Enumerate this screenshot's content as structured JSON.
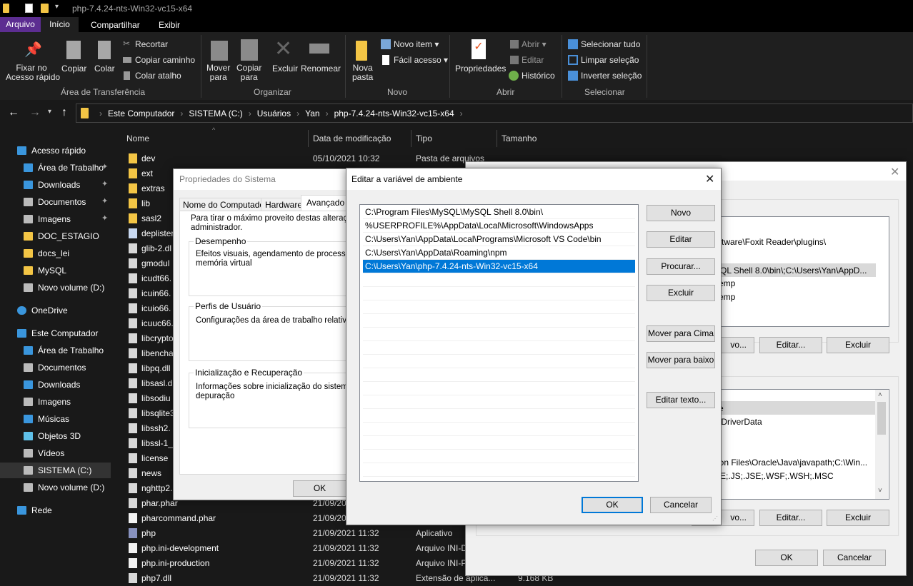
{
  "window": {
    "title": "php-7.4.24-nts-Win32-vc15-x64"
  },
  "ribbon": {
    "tabs": [
      "Arquivo",
      "Início",
      "Compartilhar",
      "Exibir"
    ],
    "clipboard": {
      "pin": "Fixar no",
      "pin2": "Acesso rápido",
      "copy": "Copiar",
      "paste": "Colar",
      "cut": "Recortar",
      "copy_path": "Copiar caminho",
      "paste_shortcut": "Colar atalho",
      "group": "Área de Transferência"
    },
    "organize": {
      "move": "Mover",
      "move2": "para",
      "copyto": "Copiar",
      "copyto2": "para",
      "delete": "Excluir",
      "rename": "Renomear",
      "group": "Organizar"
    },
    "new": {
      "new_folder": "Nova",
      "new_folder2": "pasta",
      "new_item": "Novo item",
      "easy_access": "Fácil acesso",
      "group": "Novo"
    },
    "open": {
      "properties": "Propriedades",
      "open": "Abrir",
      "edit": "Editar",
      "history": "Histórico",
      "group": "Abrir"
    },
    "select": {
      "all": "Selecionar tudo",
      "none": "Limpar seleção",
      "invert": "Inverter seleção",
      "group": "Selecionar"
    }
  },
  "breadcrumb": [
    "Este Computador",
    "SISTEMA (C:)",
    "Usuários",
    "Yan",
    "php-7.4.24-nts-Win32-vc15-x64"
  ],
  "columns": {
    "name": "Nome",
    "date": "Data de modificação",
    "type": "Tipo",
    "size": "Tamanho"
  },
  "sidebar": [
    {
      "label": "Acesso rápido",
      "icon": "star-icon",
      "ind": 0
    },
    {
      "label": "Área de Trabalho",
      "icon": "desktop-icon",
      "ind": 1,
      "pin": true
    },
    {
      "label": "Downloads",
      "icon": "download-icon",
      "ind": 1,
      "pin": true
    },
    {
      "label": "Documentos",
      "icon": "document-icon",
      "ind": 1,
      "pin": true
    },
    {
      "label": "Imagens",
      "icon": "image-icon",
      "ind": 1,
      "pin": true
    },
    {
      "label": "DOC_ESTAGIO",
      "icon": "folder-icon",
      "ind": 1
    },
    {
      "label": "docs_lei",
      "icon": "folder-icon",
      "ind": 1
    },
    {
      "label": "MySQL",
      "icon": "folder-icon",
      "ind": 1
    },
    {
      "label": "Novo volume (D:)",
      "icon": "drive-icon",
      "ind": 1
    },
    {
      "label": "OneDrive",
      "icon": "cloud-icon",
      "ind": 0,
      "gap": true
    },
    {
      "label": "Este Computador",
      "icon": "computer-icon",
      "ind": 0,
      "gap": true
    },
    {
      "label": "Área de Trabalho",
      "icon": "desktop-icon",
      "ind": 1
    },
    {
      "label": "Documentos",
      "icon": "document-icon",
      "ind": 1
    },
    {
      "label": "Downloads",
      "icon": "download-icon",
      "ind": 1
    },
    {
      "label": "Imagens",
      "icon": "image-icon",
      "ind": 1
    },
    {
      "label": "Músicas",
      "icon": "music-icon",
      "ind": 1
    },
    {
      "label": "Objetos 3D",
      "icon": "cube-icon",
      "ind": 1
    },
    {
      "label": "Vídeos",
      "icon": "video-icon",
      "ind": 1
    },
    {
      "label": "SISTEMA (C:)",
      "icon": "drive-icon",
      "ind": 1,
      "selected": true
    },
    {
      "label": "Novo volume (D:)",
      "icon": "drive-icon",
      "ind": 1
    },
    {
      "label": "Rede",
      "icon": "network-icon",
      "ind": 0,
      "gap": true
    }
  ],
  "files": [
    {
      "name": "dev",
      "kind": "folder",
      "date": "05/10/2021 10:32",
      "type": "Pasta de arquivos"
    },
    {
      "name": "ext",
      "kind": "folder"
    },
    {
      "name": "extras",
      "kind": "folder"
    },
    {
      "name": "lib",
      "kind": "folder"
    },
    {
      "name": "sasl2",
      "kind": "folder"
    },
    {
      "name": "deplister",
      "kind": "exe"
    },
    {
      "name": "glib-2.dl",
      "kind": "dll"
    },
    {
      "name": "gmodul",
      "kind": "dll"
    },
    {
      "name": "icudt66.",
      "kind": "dll"
    },
    {
      "name": "icuin66.",
      "kind": "dll"
    },
    {
      "name": "icuio66.",
      "kind": "dll"
    },
    {
      "name": "icuuc66.",
      "kind": "dll"
    },
    {
      "name": "libcrypto",
      "kind": "dll"
    },
    {
      "name": "libencha",
      "kind": "dll"
    },
    {
      "name": "libpq.dll",
      "kind": "dll"
    },
    {
      "name": "libsasl.dl",
      "kind": "dll"
    },
    {
      "name": "libsodiu",
      "kind": "dll"
    },
    {
      "name": "libsqlite3",
      "kind": "dll"
    },
    {
      "name": "libssh2.",
      "kind": "dll"
    },
    {
      "name": "libssl-1_",
      "kind": "dll"
    },
    {
      "name": "license",
      "kind": "text"
    },
    {
      "name": "news",
      "kind": "text"
    },
    {
      "name": "nghttp2.",
      "kind": "dll"
    },
    {
      "name": "phar.phar",
      "kind": "dll",
      "date": "21/09/20"
    },
    {
      "name": "pharcommand.phar",
      "kind": "blank",
      "date": "21/09/20"
    },
    {
      "name": "php",
      "kind": "php",
      "date": "21/09/2021 11:32",
      "type": "Aplicativo"
    },
    {
      "name": "php.ini-development",
      "kind": "blank",
      "date": "21/09/2021 11:32",
      "type": "Arquivo INI-D"
    },
    {
      "name": "php.ini-production",
      "kind": "blank",
      "date": "21/09/2021 11:32",
      "type": "Arquivo INI-P"
    },
    {
      "name": "php7.dll",
      "kind": "dll",
      "date": "21/09/2021 11:32",
      "type": "Extensão de aplica...",
      "size": "9.168 KB"
    }
  ],
  "sysprops": {
    "title": "Propriedades do Sistema",
    "tabs": [
      "Nome do Computador",
      "Hardware",
      "Avançado"
    ],
    "intro": "Para tirar o máximo proveito destas alterações",
    "intro2": "administrador.",
    "perf_title": "Desempenho",
    "perf_text": "Efeitos visuais, agendamento de processado",
    "perf_text2": "memória virtual",
    "profiles_title": "Perfis de Usuário",
    "profiles_text": "Configurações da área de trabalho relativas à",
    "startup_title": "Inicialização e Recuperação",
    "startup_text": "Informações sobre inicialização do sistema, fa",
    "startup_text2": "depuração",
    "ok": "OK"
  },
  "envvars": {
    "user_items": [
      "oftware\\Foxit Reader\\plugins\\",
      "SQL Shell 8.0\\bin\\;C:\\Users\\Yan\\AppD...",
      "Temp",
      "Temp"
    ],
    "sys_items": [
      "xe",
      "s\\DriverData",
      "non Files\\Oracle\\Java\\javapath;C:\\Win...",
      "BE;.JS;.JSE;.WSF;.WSH;.MSC"
    ],
    "new": "vo...",
    "edit": "Editar...",
    "delete": "Excluir",
    "ok": "OK",
    "cancel": "Cancelar"
  },
  "editvar": {
    "title": "Editar a variável de ambiente",
    "entries": [
      "C:\\Program Files\\MySQL\\MySQL Shell 8.0\\bin\\",
      "%USERPROFILE%\\AppData\\Local\\Microsoft\\WindowsApps",
      "C:\\Users\\Yan\\AppData\\Local\\Programs\\Microsoft VS Code\\bin",
      "C:\\Users\\Yan\\AppData\\Roaming\\npm",
      "C:\\Users\\Yan\\php-7.4.24-nts-Win32-vc15-x64"
    ],
    "selected_index": 4,
    "buttons": {
      "new": "Novo",
      "edit": "Editar",
      "browse": "Procurar...",
      "delete": "Excluir",
      "up": "Mover para Cima",
      "down": "Mover para baixo",
      "edit_text": "Editar texto...",
      "ok": "OK",
      "cancel": "Cancelar"
    }
  },
  "colors": {
    "accent": "#0078d7",
    "file_tab": "#5c2d91",
    "folder": "#f3c545"
  }
}
